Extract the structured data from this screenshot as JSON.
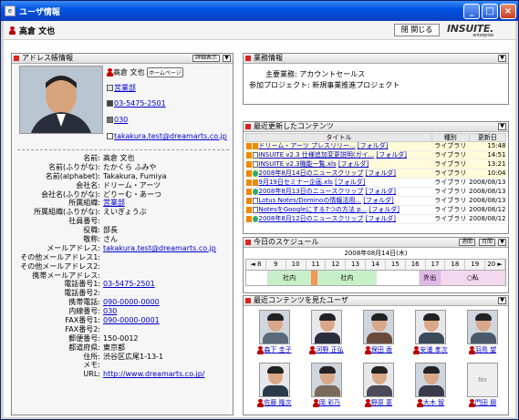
{
  "window": {
    "title": "ユーザ情報"
  },
  "header": {
    "user_name": "高倉 文也",
    "close_label": "閉 関じる",
    "logo": "INSUITE.",
    "logo_tag": "enterprise"
  },
  "address_panel": {
    "title": "アドレス帳情報",
    "detail_button": "詳細表示",
    "name": "高倉 文也",
    "homepage_badge": "ホームページ",
    "dept": "営業部",
    "tel": "03-5475-2501",
    "ext": "030",
    "email": "takakura.test@dreamarts.co.jp",
    "fields": [
      {
        "label": "名前:",
        "value": "高倉 文也"
      },
      {
        "label": "名前(ふりがな):",
        "value": "たかくら ふみや"
      },
      {
        "label": "名前(alphabet):",
        "value": "Takakura, Fumiya"
      },
      {
        "label": "会社名:",
        "value": "ドリーム・アーツ"
      },
      {
        "label": "会社名(ふりがな):",
        "value": "どりーむ・あーつ"
      },
      {
        "label": "所属組織:",
        "value": "営業部"
      },
      {
        "label": "所属組織(ふりがな):",
        "value": "えいぎょうぶ"
      },
      {
        "label": "社員番号:",
        "value": ""
      },
      {
        "label": "役職:",
        "value": "部長"
      },
      {
        "label": "敬称:",
        "value": "さん"
      },
      {
        "label": "メールアドレス:",
        "value": "takakura.test@dreamarts.co.jp"
      },
      {
        "label": "その他メールアドレス1:",
        "value": ""
      },
      {
        "label": "その他メールアドレス2:",
        "value": ""
      },
      {
        "label": "携帯メールアドレス:",
        "value": ""
      },
      {
        "label": "電話番号1:",
        "value": "03-5475-2501"
      },
      {
        "label": "電話番号2:",
        "value": ""
      },
      {
        "label": "携帯電話:",
        "value": "090-0000-0000"
      },
      {
        "label": "内線番号:",
        "value": "030"
      },
      {
        "label": "FAX番号1:",
        "value": "090-0000-0001"
      },
      {
        "label": "FAX番号2:",
        "value": ""
      },
      {
        "label": "郵便番号:",
        "value": "150-0012"
      },
      {
        "label": "都道府県:",
        "value": "東京都"
      },
      {
        "label": "住所:",
        "value": "渋谷区広尾1-13-1"
      },
      {
        "label": "メモ:",
        "value": ""
      },
      {
        "label": "URL:",
        "value": "http://www.dreamarts.co.jp/"
      }
    ]
  },
  "business": {
    "title": "業務情報",
    "duty_label": "主要業務:",
    "duty": "アカウントセールス",
    "project_label": "参加プロジェクト:",
    "project": "新規事業推進プロジェクト"
  },
  "recent": {
    "title": "最近更新したコンテンツ",
    "columns": [
      "タイトル",
      "種別",
      "更新日"
    ],
    "rows": [
      {
        "title": "ドリーム・アーツ プレスリリー...",
        "folder": "[フォルダ]",
        "type": "ライブラリ",
        "date": "15:48"
      },
      {
        "title": "INSUITE v2.3 仕様追加変更説明(ガイ...",
        "folder": "[フォルダ]",
        "type": "ライブラリ",
        "date": "14:51"
      },
      {
        "title": "INSUITE v2.3機能一覧.xls",
        "folder": "[フォルダ]",
        "type": "ライブラリ",
        "date": "13:21"
      },
      {
        "title": "2008年8月14日のニュースクリップ",
        "folder": "[フォルダ]",
        "type": "ライブラリ",
        "date": "10:04"
      },
      {
        "title": "9月19日セミナー企画.xls",
        "folder": "[フォルダ]",
        "type": "ライブラリ",
        "date": "2008/08/13"
      },
      {
        "title": "2008年8月13日のニュースクリップ",
        "folder": "[フォルダ]",
        "type": "ライブラリ",
        "date": "2008/08/13"
      },
      {
        "title": "Lotus Notes/Dominoの情報活用...",
        "folder": "[フォルダ]",
        "type": "ライブラリ",
        "date": "2008/08/13"
      },
      {
        "title": "NotesをGoogleにする7つの方法 p...",
        "folder": "[フォルダ]",
        "type": "ライブラリ",
        "date": "2008/08/12"
      },
      {
        "title": "2008年8月12日のニュースクリップ",
        "folder": "[フォルダ]",
        "type": "ライブラリ",
        "date": "2008/08/12"
      }
    ]
  },
  "schedule": {
    "title": "今日のスケジュール",
    "btn1": "週間",
    "btn2": "月間",
    "date": "2008年08月14日(木)",
    "hours": [
      "◄ 8",
      "9",
      "10",
      "11",
      "12",
      "13",
      "14",
      "15",
      "16",
      "17",
      "18",
      "19",
      "20 ►"
    ],
    "events": [
      {
        "label": "社内",
        "color": "#c8f0c8"
      },
      {
        "label": "社内",
        "color": "#c8f0c8"
      },
      {
        "label": "外出",
        "color": "#e0b8e8"
      },
      {
        "label": "○私",
        "color": "#f4d8f0"
      }
    ]
  },
  "viewers": {
    "title": "最近コンテンツを見たユーザ",
    "no_image": "No image",
    "users": [
      "森下 圭子",
      "河野 正弘",
      "保田 香",
      "安浦 孝次",
      "羽鳥 望",
      "佐藤 隆次",
      "岡 彩乃",
      "野原 恵",
      "大木 智",
      "門田 朋"
    ]
  }
}
